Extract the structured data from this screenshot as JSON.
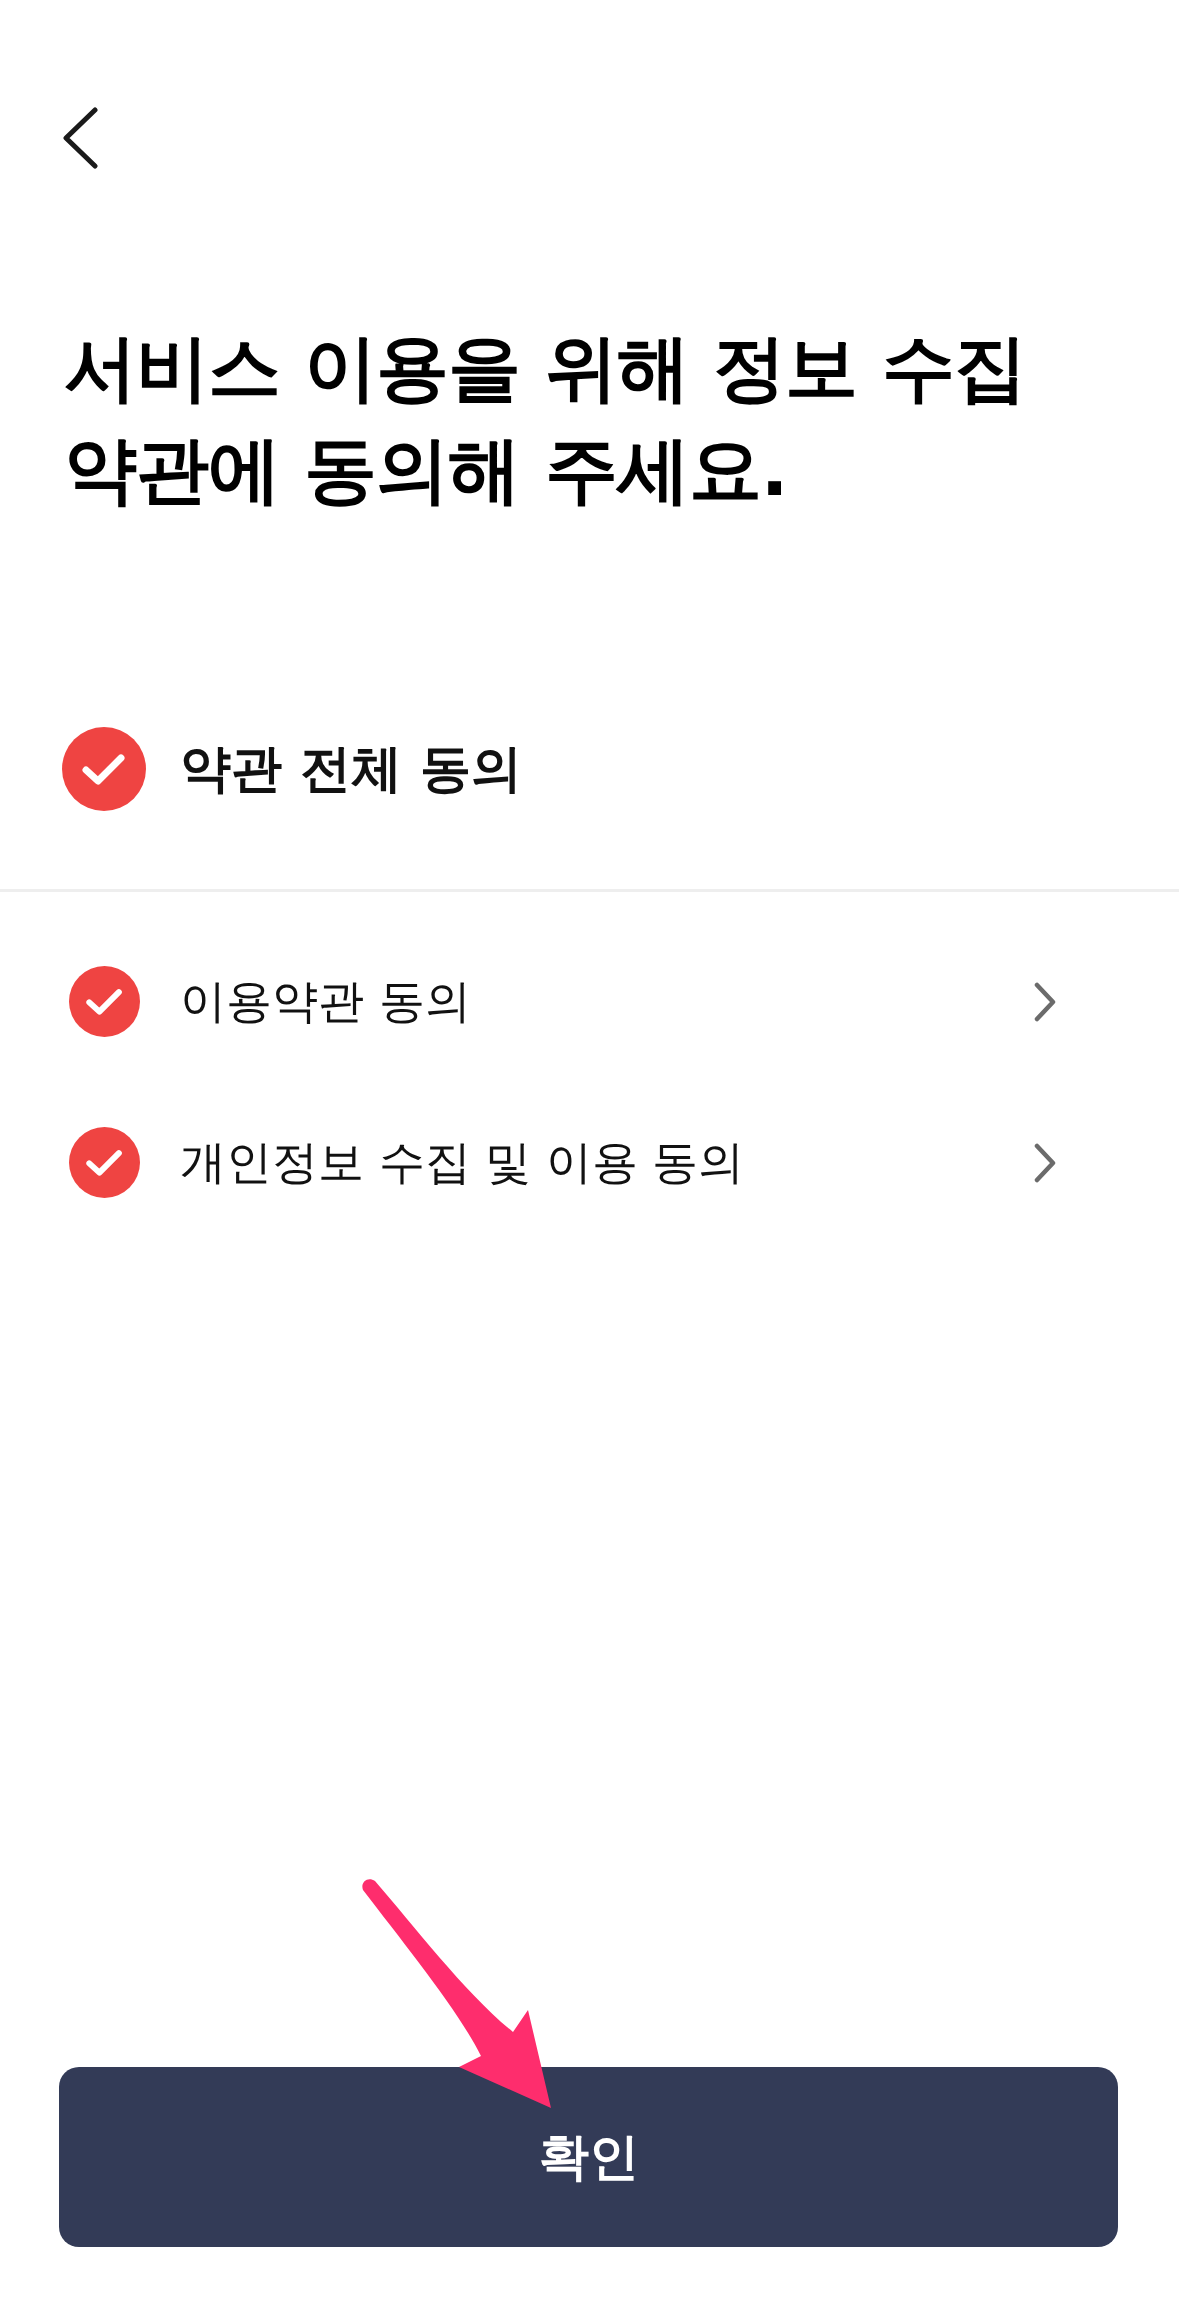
{
  "title": "서비스 이용을 위해 정보 수집 약관에 동의해 주세요.",
  "agree_all": {
    "label": "약관 전체 동의",
    "checked": true
  },
  "terms": [
    {
      "label": "이용약관 동의",
      "checked": true
    },
    {
      "label": "개인정보 수집 및 이용 동의",
      "checked": true
    }
  ],
  "confirm_button": {
    "label": "확인"
  }
}
